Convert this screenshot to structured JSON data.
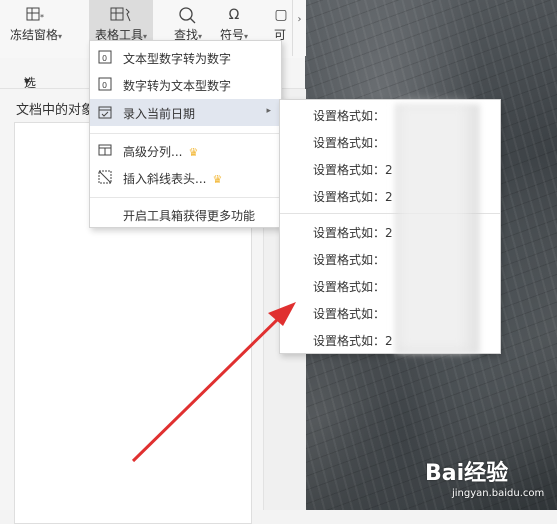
{
  "ribbon": {
    "freeze_label": "冻结窗格",
    "table_tools_label": "表格工具",
    "find_label": "查找",
    "symbol_label": "符号",
    "more_label": "可"
  },
  "pane": {
    "select_pane_label": "选择窗格",
    "objects_title": "文档中的对象"
  },
  "menu": {
    "items": [
      {
        "label": "文本型数字转为数字",
        "icon": "text-to-number-icon"
      },
      {
        "label": "数字转为文本型数字",
        "icon": "number-to-text-icon"
      },
      {
        "label": "录入当前日期",
        "icon": "calendar-check-icon"
      },
      {
        "label": "高级分列...",
        "icon": "split-columns-icon"
      },
      {
        "label": "插入斜线表头...",
        "icon": "diagonal-header-icon"
      },
      {
        "label": "开启工具箱获得更多功能"
      }
    ]
  },
  "submenu": {
    "items": [
      {
        "label": "设置格式如：",
        "value": ""
      },
      {
        "label": "设置格式如：",
        "value": ""
      },
      {
        "label": "设置格式如：",
        "value": "2"
      },
      {
        "label": "设置格式如：",
        "value": "2"
      },
      {
        "label": "设置格式如：",
        "value": "2"
      },
      {
        "label": "设置格式如：",
        "value": ""
      },
      {
        "label": "设置格式如：",
        "value": ""
      },
      {
        "label": "设置格式如：",
        "value": ""
      },
      {
        "label": "设置格式如：",
        "value": "2"
      }
    ]
  },
  "watermark": {
    "brand": "Bai经验",
    "url": "jingyan.baidu.com"
  },
  "colors": {
    "arrow": "#e03030",
    "highlight": "#e1e6ef",
    "crown": "#f2b632"
  }
}
